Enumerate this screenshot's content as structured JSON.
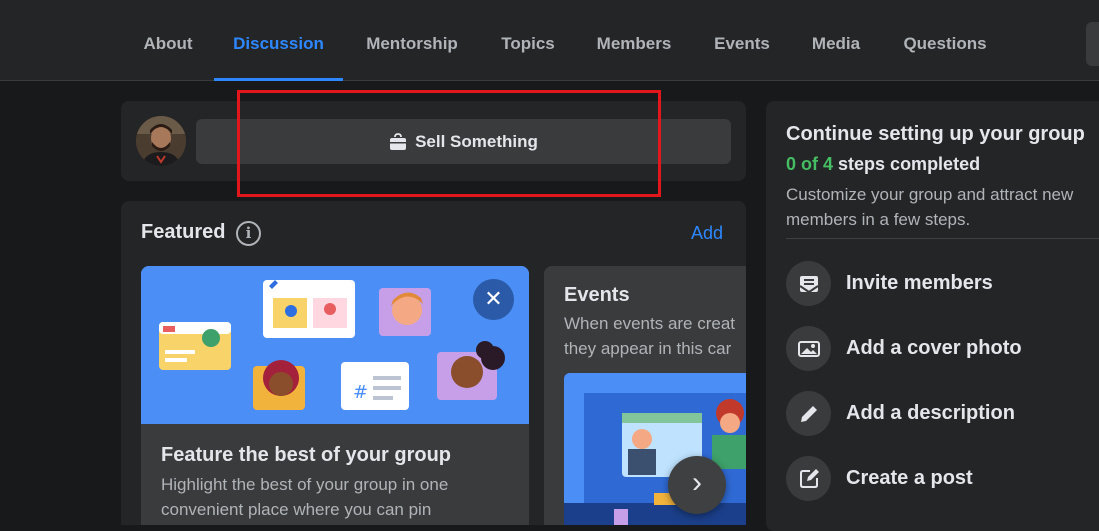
{
  "nav": {
    "tabs": [
      {
        "label": "About"
      },
      {
        "label": "Discussion",
        "active": true
      },
      {
        "label": "Mentorship"
      },
      {
        "label": "Topics"
      },
      {
        "label": "Members"
      },
      {
        "label": "Events"
      },
      {
        "label": "Media"
      },
      {
        "label": "Questions"
      }
    ]
  },
  "composer": {
    "avatar_icon": "user-avatar",
    "sell_button_label": "Sell Something",
    "sell_icon": "shopping-bag-icon"
  },
  "featured": {
    "title": "Featured",
    "info_icon": "info-icon",
    "add_label": "Add",
    "card": {
      "title": "Feature the best of your group",
      "description": "Highlight the best of your group in one convenient place where you can pin"
    },
    "events": {
      "title": "Events",
      "description_line1": "When events are creat",
      "description_line2": "they appear in this car"
    }
  },
  "setup": {
    "title": "Continue setting up your group",
    "progress_done": "0 of 4",
    "progress_rest": "steps completed",
    "description": "Customize your group and attract new members in a few steps.",
    "tasks": [
      {
        "label": "Invite members",
        "icon": "invite-envelope-icon"
      },
      {
        "label": "Add a cover photo",
        "icon": "photo-icon"
      },
      {
        "label": "Add a description",
        "icon": "pencil-icon"
      },
      {
        "label": "Create a post",
        "icon": "compose-icon"
      }
    ]
  },
  "colors": {
    "accent": "#2d88ff",
    "success": "#45bd62",
    "highlight_box": "#e3161c",
    "background": "#18191a",
    "card": "#242526"
  }
}
